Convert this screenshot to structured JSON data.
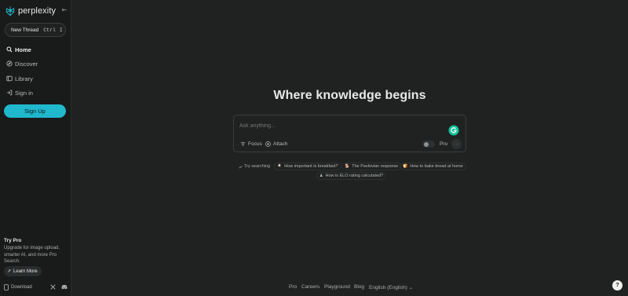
{
  "brand": {
    "name": "perplexity",
    "accent": "#20b8cd"
  },
  "sidebar": {
    "new_thread": {
      "label": "New Thread",
      "shortcut_1": "Ctrl",
      "shortcut_2": "I"
    },
    "nav": [
      {
        "label": "Home",
        "icon": "search-icon",
        "active": true
      },
      {
        "label": "Discover",
        "icon": "compass-icon"
      },
      {
        "label": "Library",
        "icon": "library-icon"
      },
      {
        "label": "Sign in",
        "icon": "sign-in-icon"
      }
    ],
    "signup_label": "Sign Up",
    "try_pro": {
      "title": "Try Pro",
      "description": "Upgrade for image upload, smarter AI, and more Pro Search.",
      "learn_more": "Learn More"
    },
    "download_label": "Download"
  },
  "main": {
    "headline": "Where knowledge begins",
    "search": {
      "placeholder": "Ask anything...",
      "focus_label": "Focus",
      "attach_label": "Attach",
      "pro_label": "Pro",
      "pro_enabled": false
    },
    "suggestions": {
      "prefix": "Try searching",
      "items": [
        {
          "emoji": "🍳",
          "label": "How important is breakfast?"
        },
        {
          "emoji": "🐕",
          "label": "The Pavlovian response"
        },
        {
          "emoji": "🍞",
          "label": "How to bake bread at home"
        },
        {
          "emoji": "♟",
          "label": "How is ELO rating calculated?"
        }
      ]
    }
  },
  "footer": {
    "links": [
      "Pro",
      "Careers",
      "Playground",
      "Blog",
      "English (English) ⌄"
    ],
    "help_label": "?"
  }
}
